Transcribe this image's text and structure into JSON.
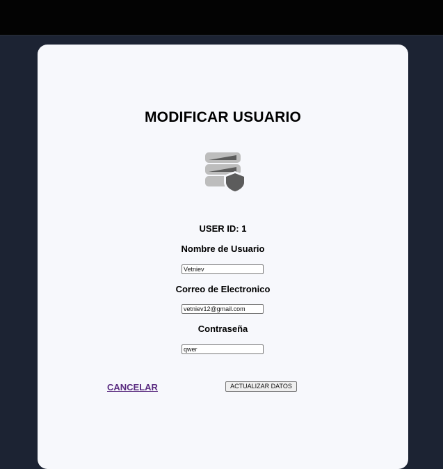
{
  "page": {
    "title": "MODIFICAR USUARIO",
    "icon": "database-shield-icon",
    "colors": {
      "background": "#1c2333",
      "topbar": "#030303",
      "card": "#f7f8fc",
      "link": "#5a2b80"
    }
  },
  "form": {
    "user_id_label": "USER ID: 1",
    "username": {
      "label": "Nombre de Usuario",
      "value": "Vetniev"
    },
    "email": {
      "label": "Correo de Electronico",
      "value": "vetniev12@gmail.com"
    },
    "password": {
      "label": "Contraseña",
      "value": "qwer"
    }
  },
  "actions": {
    "cancel_label": "CANCELAR",
    "update_label": "ACTUALIZAR DATOS"
  }
}
